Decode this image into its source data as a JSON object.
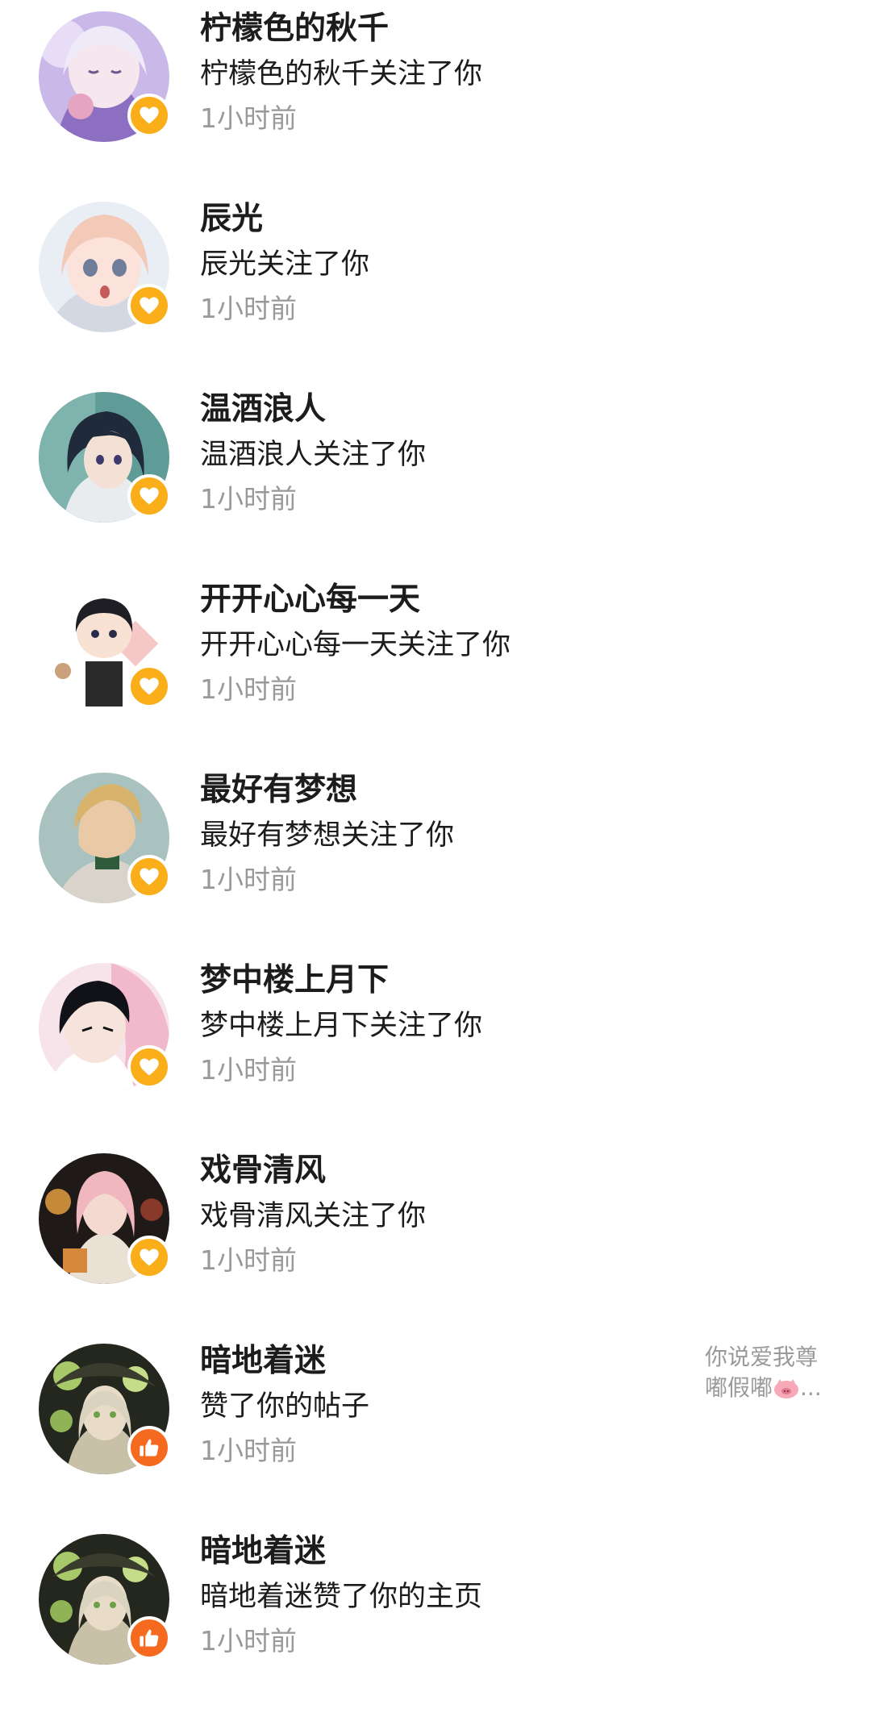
{
  "notifications": [
    {
      "name": "柠檬色的秋千",
      "message": "柠檬色的秋千关注了你",
      "time": "1小时前",
      "type": "follow"
    },
    {
      "name": "辰光",
      "message": "辰光关注了你",
      "time": "1小时前",
      "type": "follow"
    },
    {
      "name": "温酒浪人",
      "message": "温酒浪人关注了你",
      "time": "1小时前",
      "type": "follow"
    },
    {
      "name": "开开心心每一天",
      "message": "开开心心每一天关注了你",
      "time": "1小时前",
      "type": "follow"
    },
    {
      "name": "最好有梦想",
      "message": "最好有梦想关注了你",
      "time": "1小时前",
      "type": "follow"
    },
    {
      "name": "梦中楼上月下",
      "message": "梦中楼上月下关注了你",
      "time": "1小时前",
      "type": "follow"
    },
    {
      "name": "戏骨清风",
      "message": "戏骨清风关注了你",
      "time": "1小时前",
      "type": "follow"
    },
    {
      "name": "暗地着迷",
      "message": "赞了你的帖子",
      "time": "1小时前",
      "type": "like",
      "preview_line1": "你说爱我尊",
      "preview_line2": "嘟假嘟",
      "preview_icon": "pig-emoji-icon",
      "preview_suffix": "..."
    },
    {
      "name": "暗地着迷",
      "message": "暗地着迷赞了你的主页",
      "time": "1小时前",
      "type": "like"
    }
  ],
  "colors": {
    "follow_badge": "#F9AE1A",
    "like_badge": "#F56A1E",
    "name_text": "#1c1c1c",
    "time_text": "#999999"
  },
  "icons": {
    "follow": "heart-icon",
    "like": "thumbs-up-icon"
  }
}
